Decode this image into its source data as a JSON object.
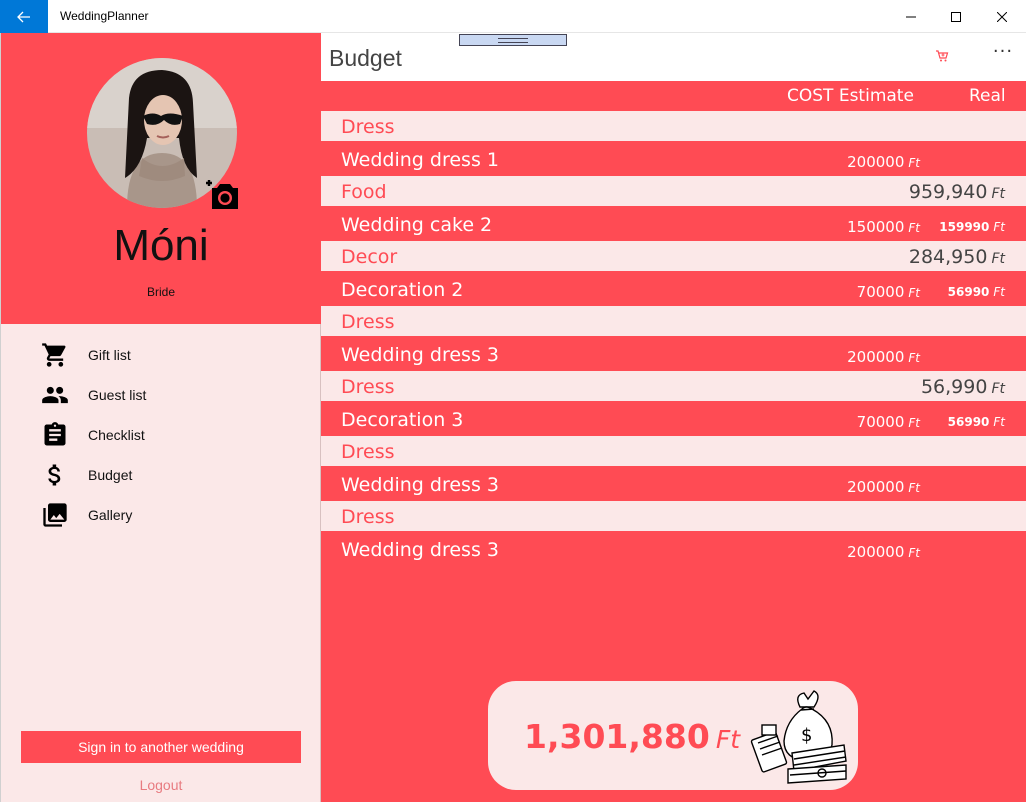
{
  "window": {
    "app_title": "WeddingPlanner"
  },
  "profile": {
    "name": "Móni",
    "role": "Bride"
  },
  "nav": {
    "items": [
      {
        "label": "Gift list",
        "icon": "cart-icon"
      },
      {
        "label": "Guest list",
        "icon": "people-icon"
      },
      {
        "label": "Checklist",
        "icon": "clipboard-icon"
      },
      {
        "label": "Budget",
        "icon": "dollar-icon"
      },
      {
        "label": "Gallery",
        "icon": "gallery-icon"
      }
    ]
  },
  "footer": {
    "signin_label": "Sign in to another wedding",
    "logout_label": "Logout"
  },
  "page": {
    "title": "Budget"
  },
  "table": {
    "header_cost": "COST Estimate",
    "header_real": "Real",
    "currency": "Ft",
    "rows": [
      {
        "type": "category",
        "name": "Dress",
        "total": ""
      },
      {
        "type": "item",
        "name": "Wedding dress 1",
        "cost": "200000",
        "real": ""
      },
      {
        "type": "category",
        "name": "Food",
        "total": "959,940"
      },
      {
        "type": "item",
        "name": "Wedding cake 2",
        "cost": "150000",
        "real": "159990"
      },
      {
        "type": "category",
        "name": "Decor",
        "total": "284,950"
      },
      {
        "type": "item",
        "name": "Decoration 2",
        "cost": "70000",
        "real": "56990"
      },
      {
        "type": "category",
        "name": "Dress",
        "total": ""
      },
      {
        "type": "item",
        "name": "Wedding dress 3",
        "cost": "200000",
        "real": ""
      },
      {
        "type": "category",
        "name": "Dress",
        "total": "56,990"
      },
      {
        "type": "item",
        "name": "Decoration 3",
        "cost": "70000",
        "real": "56990"
      },
      {
        "type": "category",
        "name": "Dress",
        "total": ""
      },
      {
        "type": "item",
        "name": "Wedding dress 3",
        "cost": "200000",
        "real": ""
      },
      {
        "type": "category",
        "name": "Dress",
        "total": ""
      },
      {
        "type": "item",
        "name": "Wedding dress 3",
        "cost": "200000",
        "real": ""
      }
    ]
  },
  "summary": {
    "total": "1,301,880",
    "currency": "Ft"
  },
  "colors": {
    "accent": "#ff4b54",
    "pane_bg": "#fbe8e8",
    "titlebar_accent": "#0078d7"
  }
}
